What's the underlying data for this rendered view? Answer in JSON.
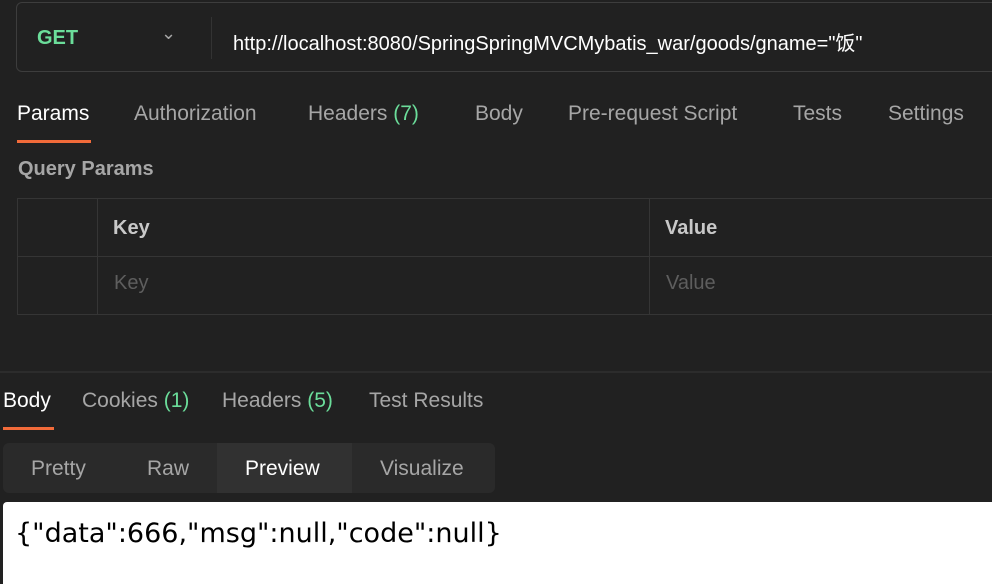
{
  "request": {
    "method": "GET",
    "url": "http://localhost:8080/SpringSpringMVCMybatis_war/goods/gname=\"饭\""
  },
  "request_tabs": [
    {
      "label": "Params"
    },
    {
      "label": "Authorization"
    },
    {
      "label": "Headers",
      "count": "(7)"
    },
    {
      "label": "Body"
    },
    {
      "label": "Pre-request Script"
    },
    {
      "label": "Tests"
    },
    {
      "label": "Settings"
    }
  ],
  "query_params": {
    "title": "Query Params",
    "headers": [
      "Key",
      "Value"
    ],
    "key_placeholder": "Key",
    "value_placeholder": "Value"
  },
  "response_tabs": [
    {
      "label": "Body"
    },
    {
      "label": "Cookies",
      "count": "(1)"
    },
    {
      "label": "Headers",
      "count": "(5)"
    },
    {
      "label": "Test Results"
    }
  ],
  "view_modes": [
    "Pretty",
    "Raw",
    "Preview",
    "Visualize"
  ],
  "active_view": "Preview",
  "response_body": "{\"data\":666,\"msg\":null,\"code\":null}",
  "colors": {
    "accent": "#f26b3a",
    "method": "#6bdd9a"
  }
}
